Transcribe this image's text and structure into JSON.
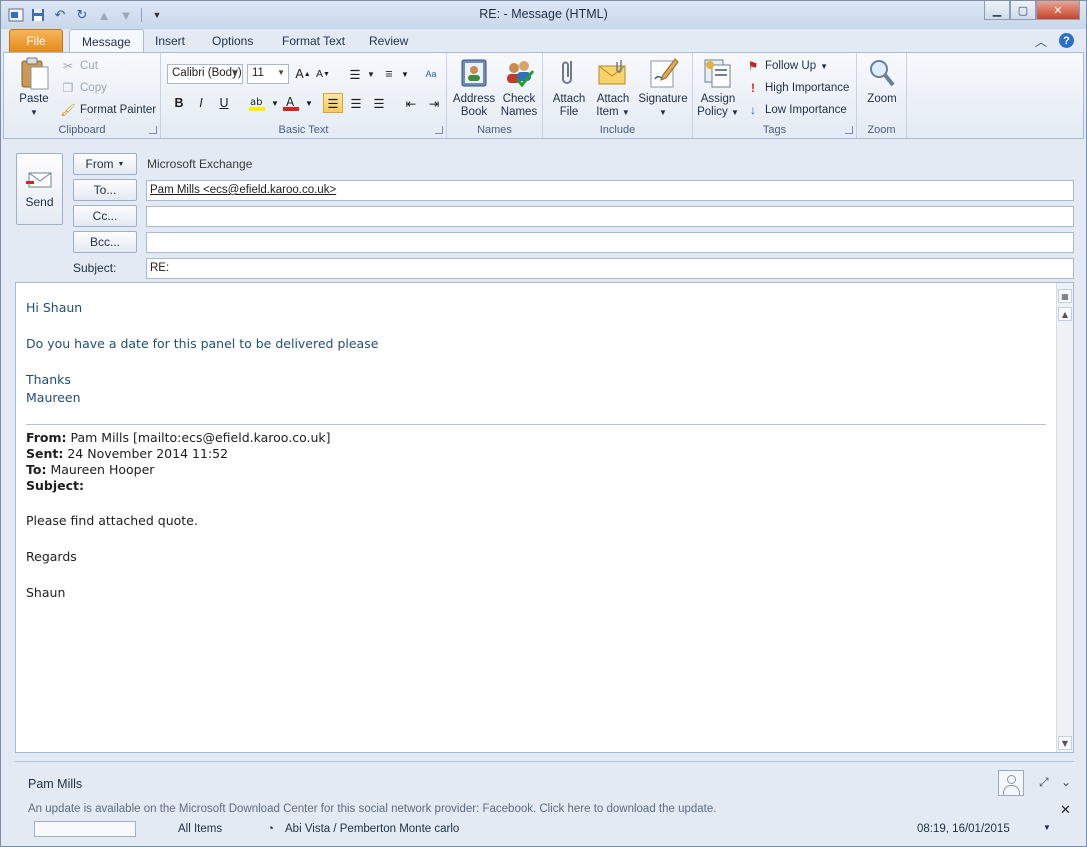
{
  "window": {
    "title": "RE:  - Message (HTML)"
  },
  "ribbon": {
    "tabs": [
      {
        "label": "File"
      },
      {
        "label": "Message"
      },
      {
        "label": "Insert"
      },
      {
        "label": "Options"
      },
      {
        "label": "Format Text"
      },
      {
        "label": "Review"
      }
    ],
    "active_tab": "Message",
    "clipboard": {
      "group_label": "Clipboard",
      "paste": "Paste",
      "cut": "Cut",
      "copy": "Copy",
      "format_painter": "Format Painter"
    },
    "basic_text": {
      "group_label": "Basic Text",
      "font": "Calibri (Body)",
      "size": "11"
    },
    "names": {
      "group_label": "Names",
      "address_book_1": "Address",
      "address_book_2": "Book",
      "check_names_1": "Check",
      "check_names_2": "Names"
    },
    "include": {
      "group_label": "Include",
      "attach_file_1": "Attach",
      "attach_file_2": "File",
      "attach_item_1": "Attach",
      "attach_item_2": "Item",
      "signature": "Signature"
    },
    "tags": {
      "group_label": "Tags",
      "assign_policy_1": "Assign",
      "assign_policy_2": "Policy",
      "follow_up": "Follow Up",
      "high_importance": "High Importance",
      "low_importance": "Low Importance"
    },
    "zoom": {
      "group_label": "Zoom",
      "zoom": "Zoom"
    }
  },
  "header": {
    "send": "Send",
    "from_button": "From",
    "from_value": "Microsoft Exchange",
    "to_button": "To...",
    "to_value": "Pam Mills <ecs@efield.karoo.co.uk>",
    "cc_button": "Cc...",
    "cc_value": "",
    "bcc_button": "Bcc...",
    "bcc_value": "",
    "subject_label": "Subject:",
    "subject_value": "RE:"
  },
  "body": {
    "greeting": "Hi Shaun",
    "line1": "Do you have a date for this panel to be delivered please",
    "thanks": "Thanks",
    "sender": "Maureen",
    "quoted": {
      "from_label": "From:",
      "from_value": "Pam Mills [mailto:ecs@efield.karoo.co.uk]",
      "sent_label": "Sent:",
      "sent_value": "24 November 2014 11:52",
      "to_label": "To:",
      "to_value": "Maureen Hooper",
      "subject_label": "Subject:",
      "subject_value": "",
      "line1": "Please find attached quote.",
      "regards": "Regards",
      "signoff": "Shaun"
    }
  },
  "people_pane": {
    "name": "Pam Mills",
    "notice": "An update is available on the Microsoft Download Center for this social network provider: Facebook. Click here to download the update.",
    "feed_all": "All Items",
    "feed_item": "Abi Vista / Pemberton Monte carlo",
    "feed_time": "08:19, 16/01/2015"
  }
}
